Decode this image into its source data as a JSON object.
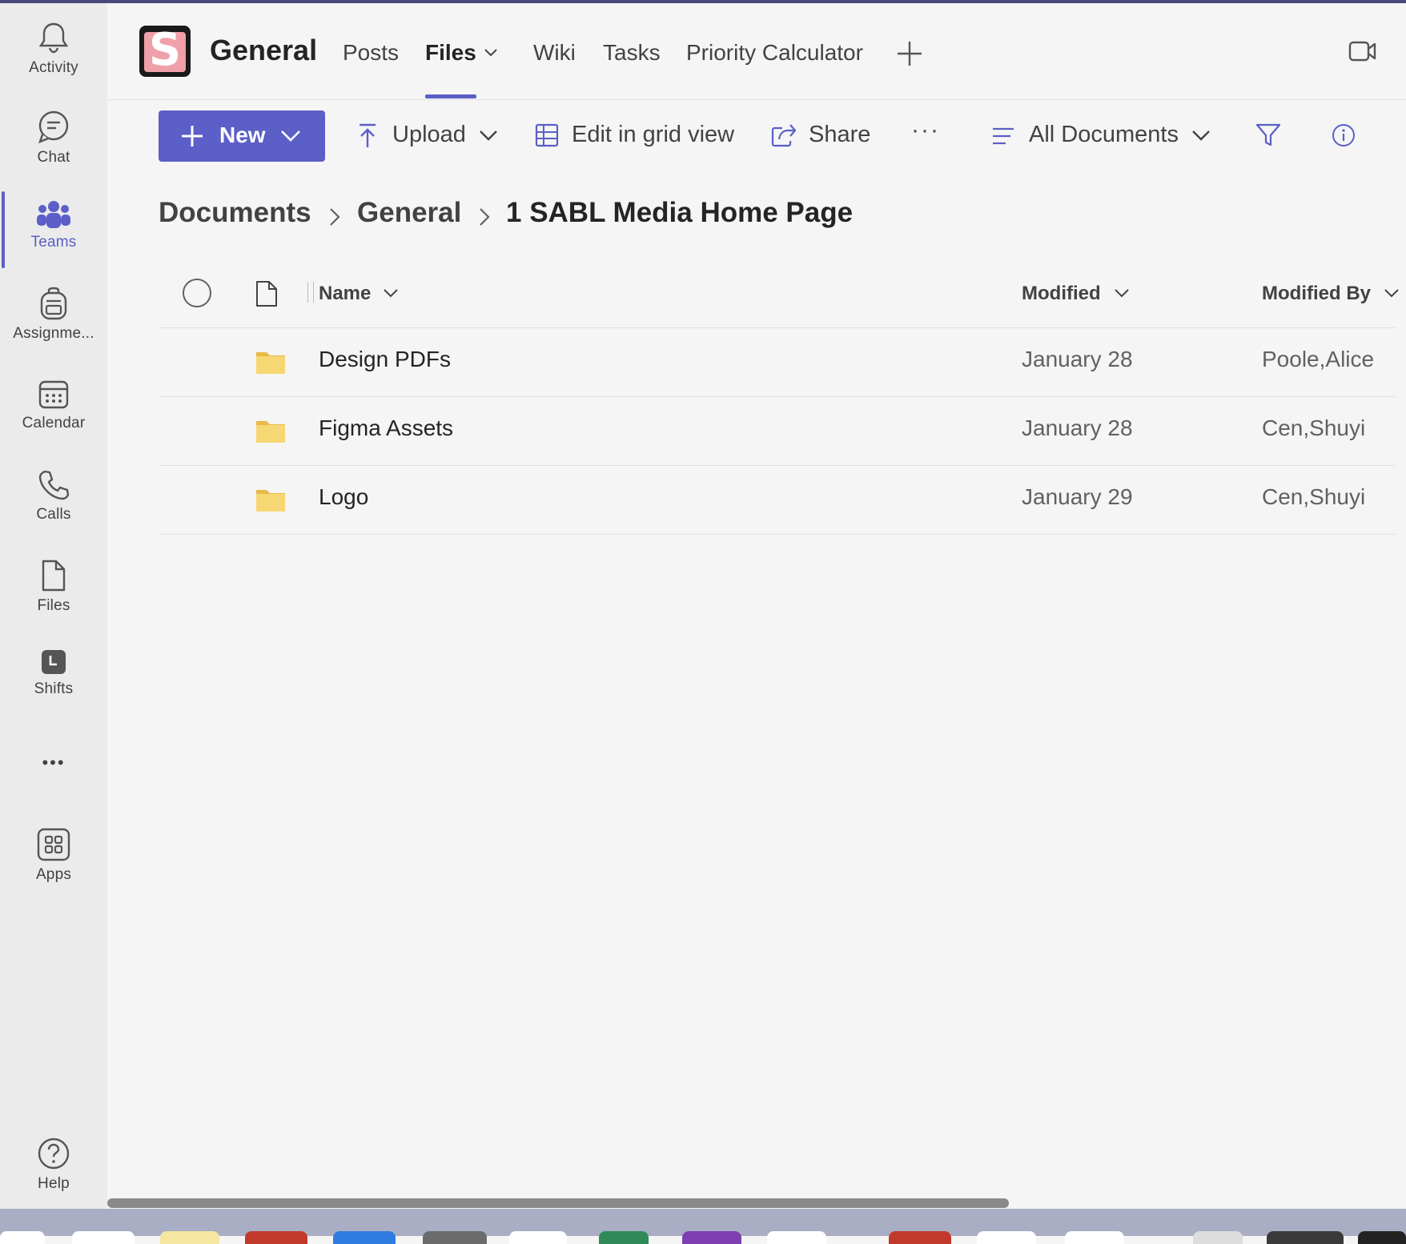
{
  "rail": {
    "activity": "Activity",
    "chat": "Chat",
    "teams": "Teams",
    "assignments": "Assignme...",
    "calendar": "Calendar",
    "calls": "Calls",
    "files": "Files",
    "shifts": "Shifts",
    "more": "•••",
    "apps": "Apps",
    "help": "Help"
  },
  "header": {
    "team_logo_letter": "S",
    "team_name": "General",
    "tabs": [
      {
        "label": "Posts"
      },
      {
        "label": "Files"
      },
      {
        "label": "Wiki"
      },
      {
        "label": "Tasks"
      },
      {
        "label": "Priority Calculator"
      }
    ],
    "active_tab": "Files"
  },
  "toolbar": {
    "new_label": "New",
    "upload_label": "Upload",
    "grid_label": "Edit in grid view",
    "share_label": "Share",
    "more_label": "···",
    "view_label": "All Documents"
  },
  "breadcrumb": [
    "Documents",
    "General",
    "1 SABL Media Home Page"
  ],
  "table": {
    "columns": {
      "name": "Name",
      "modified": "Modified",
      "modified_by": "Modified By"
    },
    "rows": [
      {
        "name": "Design PDFs",
        "modified": "January 28",
        "modified_by": "Poole,Alice",
        "type": "folder"
      },
      {
        "name": "Figma Assets",
        "modified": "January 28",
        "modified_by": "Cen,Shuyi",
        "type": "folder"
      },
      {
        "name": "Logo",
        "modified": "January 29",
        "modified_by": "Cen,Shuyi",
        "type": "folder"
      }
    ]
  },
  "colors": {
    "accent": "#5b5fc7",
    "folder": "#f7d774"
  }
}
